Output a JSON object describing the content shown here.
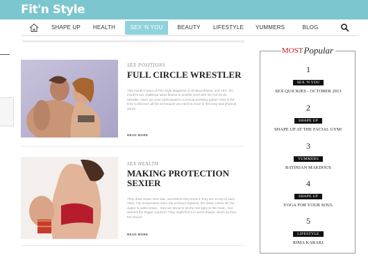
{
  "brand": {
    "logo": "Fit'n Style"
  },
  "nav": {
    "items": [
      {
        "label": "SHAPE UP"
      },
      {
        "label": "HEALTH"
      },
      {
        "label": "SEX 'N YOU"
      },
      {
        "label": "BEAUTY"
      },
      {
        "label": "LIFESTYLE"
      },
      {
        "label": "YUMMERS"
      },
      {
        "label": "BLOG"
      }
    ],
    "active": "SEX 'N YOU",
    "icons": [
      "home-icon",
      "search-icon"
    ]
  },
  "articles": [
    {
      "kicker": "SEX POSITIONS",
      "title": "FULL CIRCLE WRESTLER",
      "excerpt": "This month's issue of Fit'n Style Magazine is all about fitness, and YES, the month's sex challenge takes fitness to another level with the Full Circle Wrestler. Have you ever participated in a sexual wrestling game? Now is the time to discover all the techniques you need to excel in this sexy and physical dance.",
      "more": "READ MORE"
    },
    {
      "kicker": "SEX HEALTH",
      "title": "MAKING PROTECTION SEXIER",
      "excerpt": "They draw closer, then kiss, and before they know it, they are on top of each other. The temperature rises, the embrace tightens, the dress comes off, the zipper is pulled down... they are about to hit the nail right on the head... but where's the trigger condom? They might find it in some drawer, which by then, the sexual",
      "more": "READ MORE"
    }
  ],
  "popular": {
    "heading_most": "MOST",
    "heading_popular": "Popular",
    "items": [
      {
        "rank": "1",
        "category": "SEX 'N YOU",
        "title": "SEX QUICKIES - OCTOBER 2013"
      },
      {
        "rank": "2",
        "category": "SHAPE UP",
        "title": "SHAPE UP AT THE FACIAL GYM!"
      },
      {
        "rank": "3",
        "category": "YUMMERS",
        "title": "BATINJAN MAKDOUS"
      },
      {
        "rank": "4",
        "category": "SHAPE UP",
        "title": "YOGA FOR YOUR SOUL"
      },
      {
        "rank": "5",
        "category": "LIFESTYLE",
        "title": "RIMA KARAKI"
      }
    ]
  },
  "colors": {
    "topbar": "#7bc6cf",
    "nav_active": "#8fd3dc",
    "most_red": "#c02020",
    "badge": "#111111"
  }
}
